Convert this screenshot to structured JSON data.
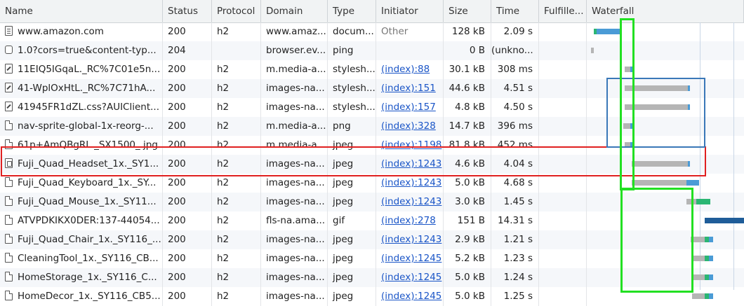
{
  "columns": [
    "Name",
    "Status",
    "Protocol",
    "Domain",
    "Type",
    "Initiator",
    "Size",
    "Time",
    "Fulfille...",
    "Waterfall"
  ],
  "rows": [
    {
      "icon": "document-icon",
      "kind": "doc",
      "name": "www.amazon.com",
      "status": "200",
      "protocol": "h2",
      "domain": "www.amaz...",
      "type": "docum...",
      "initiator": "Other",
      "initiator_link": false,
      "size": "128 kB",
      "time": "2.09 s"
    },
    {
      "icon": "ping-icon",
      "kind": "ping",
      "name": "1.0?cors=true&content-typ...",
      "status": "204",
      "protocol": "",
      "domain": "browser.ev...",
      "type": "ping",
      "initiator": "",
      "initiator_link": false,
      "size": "0 B",
      "time": "(unkno..."
    },
    {
      "icon": "stylesheet-icon",
      "kind": "css",
      "name": "11EIQ5IGqaL._RC%7C01e5n...",
      "status": "200",
      "protocol": "h2",
      "domain": "m.media-a...",
      "type": "stylesh...",
      "initiator": "(index):88",
      "initiator_link": true,
      "size": "30.1 kB",
      "time": "308 ms"
    },
    {
      "icon": "stylesheet-icon",
      "kind": "css",
      "name": "41-WplOxHtL._RC%7C71hA...",
      "status": "200",
      "protocol": "h2",
      "domain": "images-na...",
      "type": "stylesh...",
      "initiator": "(index):151",
      "initiator_link": true,
      "size": "44.6 kB",
      "time": "4.51 s"
    },
    {
      "icon": "stylesheet-icon",
      "kind": "css",
      "name": "41945FR1dZL.css?AUIClient...",
      "status": "200",
      "protocol": "h2",
      "domain": "images-na...",
      "type": "stylesh...",
      "initiator": "(index):157",
      "initiator_link": true,
      "size": "4.8 kB",
      "time": "4.50 s"
    },
    {
      "icon": "image-file-icon",
      "kind": "img",
      "name": "nav-sprite-global-1x-reorg-...",
      "status": "200",
      "protocol": "h2",
      "domain": "m.media-a...",
      "type": "png",
      "initiator": "(index):328",
      "initiator_link": true,
      "size": "14.7 kB",
      "time": "396 ms"
    },
    {
      "icon": "image-file-icon",
      "kind": "img",
      "name": "61p+AmQBgRL._SX1500_.jpg",
      "status": "200",
      "protocol": "h2",
      "domain": "m.media-a...",
      "type": "jpeg",
      "initiator": "(index):1198",
      "initiator_link": true,
      "size": "81.8 kB",
      "time": "452 ms"
    },
    {
      "icon": "image-file-icon",
      "kind": "js",
      "name": "Fuji_Quad_Headset_1x._SY1...",
      "status": "200",
      "protocol": "h2",
      "domain": "images-na...",
      "type": "jpeg",
      "initiator": "(index):1243",
      "initiator_link": true,
      "size": "4.6 kB",
      "time": "4.04 s"
    },
    {
      "icon": "image-file-icon",
      "kind": "img",
      "name": "Fuji_Quad_Keyboard_1x._SY...",
      "status": "200",
      "protocol": "h2",
      "domain": "images-na...",
      "type": "jpeg",
      "initiator": "(index):1243",
      "initiator_link": true,
      "size": "5.0 kB",
      "time": "4.68 s"
    },
    {
      "icon": "image-file-icon",
      "kind": "img",
      "name": "Fuji_Quad_Mouse_1x._SY11...",
      "status": "200",
      "protocol": "h2",
      "domain": "images-na...",
      "type": "jpeg",
      "initiator": "(index):1243",
      "initiator_link": true,
      "size": "3.0 kB",
      "time": "1.45 s"
    },
    {
      "icon": "image-file-icon",
      "kind": "img",
      "name": "ATVPDKIKX0DER:137-44054...",
      "status": "200",
      "protocol": "h2",
      "domain": "fls-na.ama...",
      "type": "gif",
      "initiator": "(index):278",
      "initiator_link": true,
      "size": "151 B",
      "time": "14.31 s"
    },
    {
      "icon": "image-file-icon",
      "kind": "img",
      "name": "Fuji_Quad_Chair_1x._SY116_...",
      "status": "200",
      "protocol": "h2",
      "domain": "images-na...",
      "type": "jpeg",
      "initiator": "(index):1243",
      "initiator_link": true,
      "size": "2.9 kB",
      "time": "1.21 s"
    },
    {
      "icon": "image-file-icon",
      "kind": "img",
      "name": "CleaningTool_1x._SY116_CB...",
      "status": "200",
      "protocol": "h2",
      "domain": "images-na...",
      "type": "jpeg",
      "initiator": "(index):1245",
      "initiator_link": true,
      "size": "5.2 kB",
      "time": "1.23 s"
    },
    {
      "icon": "image-file-icon",
      "kind": "img",
      "name": "HomeStorage_1x._SY116_C...",
      "status": "200",
      "protocol": "h2",
      "domain": "images-na...",
      "type": "jpeg",
      "initiator": "(index):1245",
      "initiator_link": true,
      "size": "5.0 kB",
      "time": "1.24 s"
    },
    {
      "icon": "image-file-icon",
      "kind": "img",
      "name": "HomeDecor_1x._SY116_CB5...",
      "status": "200",
      "protocol": "h2",
      "domain": "images-na...",
      "type": "jpeg",
      "initiator": "(index):1245",
      "initiator_link": true,
      "size": "5.0 kB",
      "time": "1.25 s"
    }
  ],
  "colors": {
    "header_bg": "#f1f3f4",
    "link": "#1a55c7",
    "highlight_red": "#e02020",
    "highlight_blue": "#3a78b8",
    "highlight_green": "#22e022",
    "bar_wait": "#b5b5b5",
    "bar_download": "#4a9bd6",
    "bar_connect": "#2bb673",
    "bar_long": "#1f5d99"
  }
}
